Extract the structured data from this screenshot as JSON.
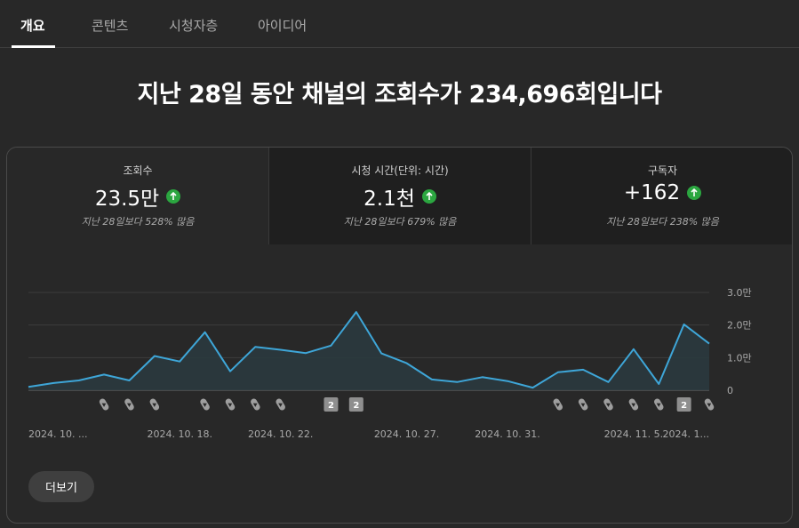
{
  "tabs": [
    {
      "label": "개요",
      "active": true
    },
    {
      "label": "콘텐츠",
      "active": false
    },
    {
      "label": "시청자층",
      "active": false
    },
    {
      "label": "아이디어",
      "active": false
    }
  ],
  "headline": "지난 28일 동안 채널의 조회수가 234,696회입니다",
  "metrics": [
    {
      "label": "조회수",
      "value": "23.5만",
      "note": "지난 28일보다 528% 많음",
      "trend_icon": "arrow-up-icon"
    },
    {
      "label": "시청 시간(단위: 시간)",
      "value": "2.1천",
      "note": "지난 28일보다 679% 많음",
      "trend_icon": "arrow-up-icon"
    },
    {
      "label": "구독자",
      "value": "+162",
      "note": "지난 28일보다 238% 많음",
      "trend_icon": "arrow-up-icon"
    }
  ],
  "colors": {
    "line": "#3ea6d8",
    "area": "#2a3a40",
    "trend_up": "#2ba640"
  },
  "chart_data": {
    "type": "area",
    "x_tick_labels": [
      "2024. 10. ...",
      "2024. 10. 18.",
      "2024. 10. 22.",
      "2024. 10. 27.",
      "2024. 10. 31.",
      "2024. 11. 5.",
      "2024. 1..."
    ],
    "y_tick_labels": [
      "0",
      "1.0만",
      "2.0만",
      "3.0만"
    ],
    "ylim": [
      0,
      30000
    ],
    "grid": true,
    "series": [
      {
        "values": [
          1000,
          2200,
          3000,
          4800,
          3000,
          10500,
          8800,
          17800,
          5800,
          13300,
          12400,
          11400,
          13700,
          24000,
          11300,
          8300,
          3300,
          2500,
          4000,
          2800,
          800,
          5500,
          6300,
          2500,
          12600,
          1900,
          20200,
          14300
        ]
      }
    ],
    "markers": [
      {
        "index": 3,
        "type": "shorts-icon"
      },
      {
        "index": 4,
        "type": "shorts-icon"
      },
      {
        "index": 5,
        "type": "shorts-icon"
      },
      {
        "index": 7,
        "type": "shorts-icon"
      },
      {
        "index": 8,
        "type": "shorts-icon"
      },
      {
        "index": 9,
        "type": "shorts-icon"
      },
      {
        "index": 10,
        "type": "shorts-icon"
      },
      {
        "index": 12,
        "type": "badge",
        "label": "2"
      },
      {
        "index": 13,
        "type": "badge",
        "label": "2"
      },
      {
        "index": 21,
        "type": "shorts-icon"
      },
      {
        "index": 22,
        "type": "shorts-icon"
      },
      {
        "index": 23,
        "type": "shorts-icon"
      },
      {
        "index": 24,
        "type": "shorts-icon"
      },
      {
        "index": 25,
        "type": "shorts-icon"
      },
      {
        "index": 26,
        "type": "badge",
        "label": "2"
      },
      {
        "index": 27,
        "type": "shorts-icon"
      }
    ]
  },
  "more_button": "더보기"
}
